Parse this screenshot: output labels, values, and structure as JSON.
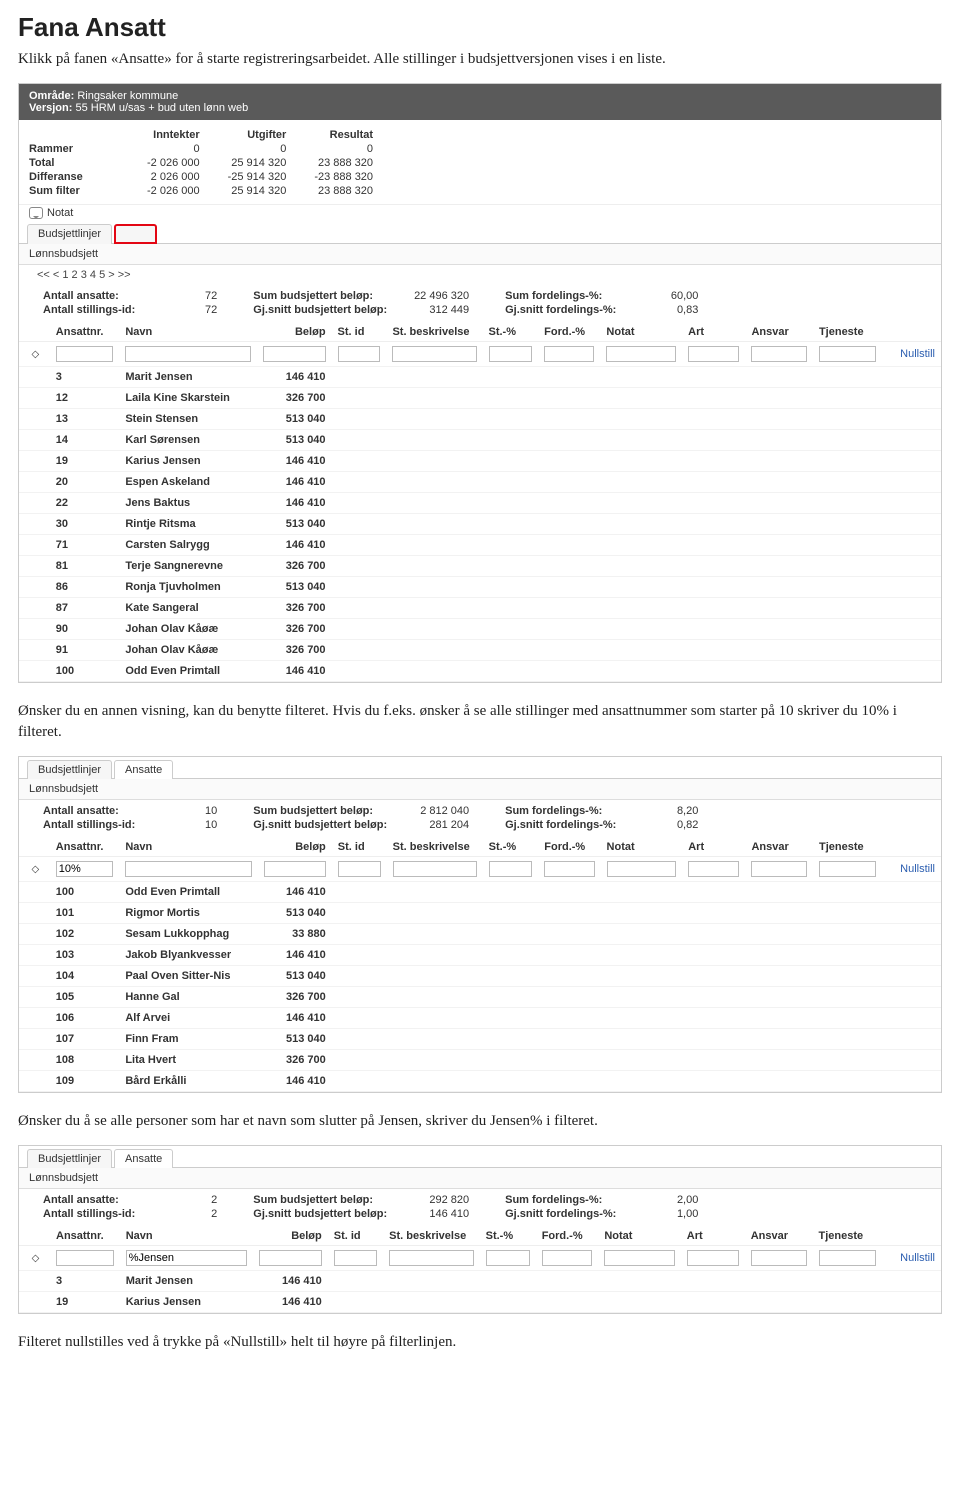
{
  "doc": {
    "title": "Fana Ansatt",
    "p1": "Klikk på fanen «Ansatte» for å starte registreringsarbeidet. Alle stillinger i budsjettversjonen vises i en liste.",
    "p2": "Ønsker du en annen visning, kan du benytte filteret. Hvis du f.eks. ønsker å se alle stillinger med ansattnummer som starter på 10 skriver du 10% i filteret.",
    "p3": "Ønsker du å se alle personer som har et navn som slutter på Jensen, skriver du  Jensen% i filteret.",
    "p4": "Filteret nullstilles ved å trykke på «Nullstill» helt til høyre på filterlinjen."
  },
  "app1": {
    "header": {
      "omrade_lbl": "Område:",
      "omrade": "Ringsaker kommune",
      "versjon_lbl": "Versjon:",
      "versjon": "55 HRM u/sas + bud uten lønn web"
    },
    "summary": {
      "cols": [
        "Inntekter",
        "Utgifter",
        "Resultat"
      ],
      "rows": [
        {
          "lbl": "Rammer",
          "v": [
            "0",
            "0",
            "0"
          ]
        },
        {
          "lbl": "Total",
          "v": [
            "-2 026 000",
            "25 914 320",
            "23 888 320"
          ]
        },
        {
          "lbl": "Differanse",
          "v": [
            "2 026 000",
            "-25 914 320",
            "-23 888 320"
          ]
        },
        {
          "lbl": "Sum filter",
          "v": [
            "-2 026 000",
            "25 914 320",
            "23 888 320"
          ]
        }
      ]
    },
    "notat": "Notat",
    "tabs": {
      "budsjett": "Budsjettlinjer",
      "lonn": "Lønnsbudsjett"
    },
    "pager": "<< < 1 2 3 4 5 > >>",
    "stats": {
      "a_ansatte_lbl": "Antall ansatte:",
      "a_ansatte": "72",
      "a_still_lbl": "Antall stillings-id:",
      "a_still": "72",
      "sum_lbl": "Sum budsjettert beløp:",
      "sum": "22 496 320",
      "gj_lbl": "Gj.snitt budsjettert beløp:",
      "gj": "312 449",
      "sf_lbl": "Sum fordelings-%:",
      "sf": "60,00",
      "gjf_lbl": "Gj.snitt fordelings-%:",
      "gjf": "0,83"
    },
    "headers": [
      "Ansattnr.",
      "Navn",
      "Beløp",
      "St. id",
      "St. beskrivelse",
      "St.-%",
      "Ford.-%",
      "Notat",
      "Art",
      "Ansvar",
      "Tjeneste"
    ],
    "nullstill": "Nullstill",
    "filter": {
      "ansattnr": "",
      "navn": ""
    },
    "rows": [
      {
        "nr": "3",
        "navn": "Marit Jensen",
        "belop": "146 410"
      },
      {
        "nr": "12",
        "navn": "Laila Kine Skarstein",
        "belop": "326 700"
      },
      {
        "nr": "13",
        "navn": "Stein Stensen",
        "belop": "513 040"
      },
      {
        "nr": "14",
        "navn": "Karl Sørensen",
        "belop": "513 040"
      },
      {
        "nr": "19",
        "navn": "Karius Jensen",
        "belop": "146 410"
      },
      {
        "nr": "20",
        "navn": "Espen Askeland",
        "belop": "146 410"
      },
      {
        "nr": "22",
        "navn": "Jens Baktus",
        "belop": "146 410"
      },
      {
        "nr": "30",
        "navn": "Rintje Ritsma",
        "belop": "513 040"
      },
      {
        "nr": "71",
        "navn": "Carsten Salrygg",
        "belop": "146 410"
      },
      {
        "nr": "81",
        "navn": "Terje Sangnerevne",
        "belop": "326 700"
      },
      {
        "nr": "86",
        "navn": "Ronja Tjuvholmen",
        "belop": "513 040"
      },
      {
        "nr": "87",
        "navn": "Kate Sangeral",
        "belop": "326 700"
      },
      {
        "nr": "90",
        "navn": "Johan Olav Kåøæ",
        "belop": "326 700"
      },
      {
        "nr": "91",
        "navn": "Johan Olav Kåøæ",
        "belop": "326 700"
      },
      {
        "nr": "100",
        "navn": "Odd Even Primtall",
        "belop": "146 410"
      }
    ]
  },
  "app2": {
    "tabs": {
      "budsjett": "Budsjettlinjer",
      "ansatte": "Ansatte",
      "lonn": "Lønnsbudsjett"
    },
    "stats": {
      "a_ansatte_lbl": "Antall ansatte:",
      "a_ansatte": "10",
      "a_still_lbl": "Antall stillings-id:",
      "a_still": "10",
      "sum_lbl": "Sum budsjettert beløp:",
      "sum": "2 812 040",
      "gj_lbl": "Gj.snitt budsjettert beløp:",
      "gj": "281 204",
      "sf_lbl": "Sum fordelings-%:",
      "sf": "8,20",
      "gjf_lbl": "Gj.snitt fordelings-%:",
      "gjf": "0,82"
    },
    "headers": [
      "Ansattnr.",
      "Navn",
      "Beløp",
      "St. id",
      "St. beskrivelse",
      "St.-%",
      "Ford.-%",
      "Notat",
      "Art",
      "Ansvar",
      "Tjeneste"
    ],
    "nullstill": "Nullstill",
    "filter": {
      "ansattnr": "10%",
      "navn": ""
    },
    "rows": [
      {
        "nr": "100",
        "navn": "Odd Even Primtall",
        "belop": "146 410"
      },
      {
        "nr": "101",
        "navn": "Rigmor Mortis",
        "belop": "513 040"
      },
      {
        "nr": "102",
        "navn": "Sesam Lukkopphag",
        "belop": "33 880"
      },
      {
        "nr": "103",
        "navn": "Jakob Blyankvesser",
        "belop": "146 410"
      },
      {
        "nr": "104",
        "navn": "Paal Oven Sitter-Nis",
        "belop": "513 040"
      },
      {
        "nr": "105",
        "navn": "Hanne Gal",
        "belop": "326 700"
      },
      {
        "nr": "106",
        "navn": "Alf Arvei",
        "belop": "146 410"
      },
      {
        "nr": "107",
        "navn": "Finn Fram",
        "belop": "513 040"
      },
      {
        "nr": "108",
        "navn": "Lita Hvert",
        "belop": "326 700"
      },
      {
        "nr": "109",
        "navn": "Bård Erkålli",
        "belop": "146 410"
      }
    ]
  },
  "app3": {
    "tabs": {
      "budsjett": "Budsjettlinjer",
      "ansatte": "Ansatte",
      "lonn": "Lønnsbudsjett"
    },
    "stats": {
      "a_ansatte_lbl": "Antall ansatte:",
      "a_ansatte": "2",
      "a_still_lbl": "Antall stillings-id:",
      "a_still": "2",
      "sum_lbl": "Sum budsjettert beløp:",
      "sum": "292 820",
      "gj_lbl": "Gj.snitt budsjettert beløp:",
      "gj": "146 410",
      "sf_lbl": "Sum fordelings-%:",
      "sf": "2,00",
      "gjf_lbl": "Gj.snitt fordelings-%:",
      "gjf": "1,00"
    },
    "headers": [
      "Ansattnr.",
      "Navn",
      "Beløp",
      "St. id",
      "St. beskrivelse",
      "St.-%",
      "Ford.-%",
      "Notat",
      "Art",
      "Ansvar",
      "Tjeneste"
    ],
    "nullstill": "Nullstill",
    "filter": {
      "ansattnr": "",
      "navn": "%Jensen"
    },
    "rows": [
      {
        "nr": "3",
        "navn": "Marit Jensen",
        "belop": "146 410"
      },
      {
        "nr": "19",
        "navn": "Karius Jensen",
        "belop": "146 410"
      }
    ]
  }
}
